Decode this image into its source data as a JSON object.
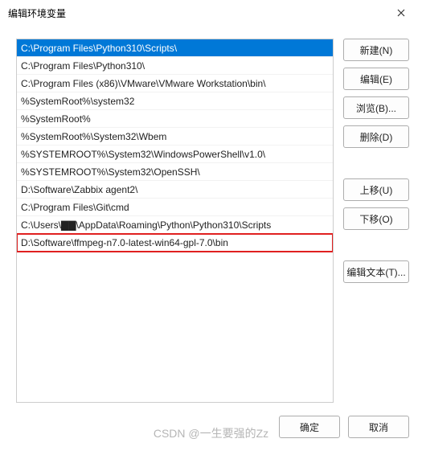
{
  "window": {
    "title": "编辑环境变量"
  },
  "list": {
    "items": [
      {
        "value": "C:\\Program Files\\Python310\\Scripts\\",
        "selected": true,
        "highlighted": false
      },
      {
        "value": "C:\\Program Files\\Python310\\",
        "selected": false,
        "highlighted": false
      },
      {
        "value": "C:\\Program Files (x86)\\VMware\\VMware Workstation\\bin\\",
        "selected": false,
        "highlighted": false
      },
      {
        "value": "%SystemRoot%\\system32",
        "selected": false,
        "highlighted": false
      },
      {
        "value": "%SystemRoot%",
        "selected": false,
        "highlighted": false
      },
      {
        "value": "%SystemRoot%\\System32\\Wbem",
        "selected": false,
        "highlighted": false
      },
      {
        "value": "%SYSTEMROOT%\\System32\\WindowsPowerShell\\v1.0\\",
        "selected": false,
        "highlighted": false
      },
      {
        "value": "%SYSTEMROOT%\\System32\\OpenSSH\\",
        "selected": false,
        "highlighted": false
      },
      {
        "value": "D:\\Software\\Zabbix agent2\\",
        "selected": false,
        "highlighted": false
      },
      {
        "value": "C:\\Program Files\\Git\\cmd",
        "selected": false,
        "highlighted": false
      },
      {
        "value": "C:\\Users\\▇▇\\AppData\\Roaming\\Python\\Python310\\Scripts",
        "selected": false,
        "highlighted": false
      },
      {
        "value": "D:\\Software\\ffmpeg-n7.0-latest-win64-gpl-7.0\\bin",
        "selected": false,
        "highlighted": true
      }
    ]
  },
  "buttons": {
    "new": "新建(N)",
    "edit": "编辑(E)",
    "browse": "浏览(B)...",
    "delete": "删除(D)",
    "moveUp": "上移(U)",
    "moveDown": "下移(O)",
    "editText": "编辑文本(T)...",
    "ok": "确定",
    "cancel": "取消"
  },
  "watermark": "CSDN @一生要强的Zz"
}
